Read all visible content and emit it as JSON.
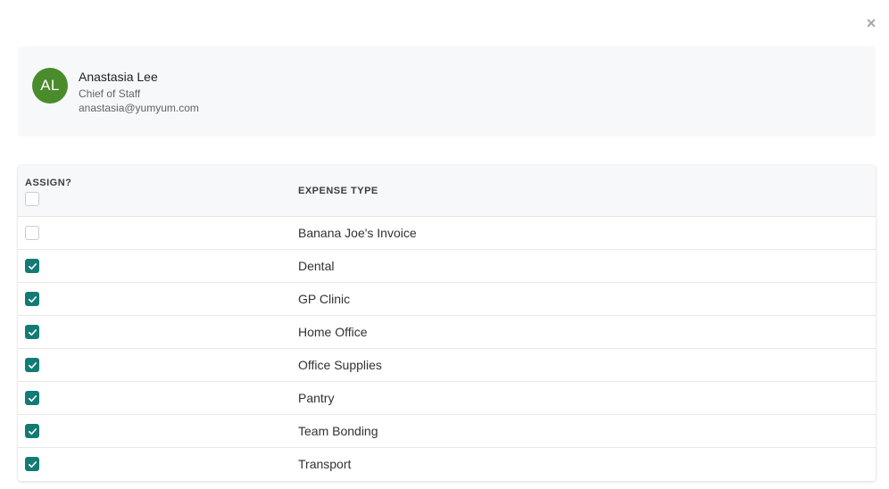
{
  "close_label": "×",
  "profile": {
    "initials": "AL",
    "name": "Anastasia Lee",
    "role": "Chief of Staff",
    "email": "anastasia@yumyum.com"
  },
  "table": {
    "header_assign": "ASSIGN?",
    "header_type": "EXPENSE TYPE",
    "header_checked": false,
    "rows": [
      {
        "label": "Banana Joe's Invoice",
        "checked": false
      },
      {
        "label": "Dental",
        "checked": true
      },
      {
        "label": "GP Clinic",
        "checked": true
      },
      {
        "label": "Home Office",
        "checked": true
      },
      {
        "label": "Office Supplies",
        "checked": true
      },
      {
        "label": "Pantry",
        "checked": true
      },
      {
        "label": "Team Bonding",
        "checked": true
      },
      {
        "label": "Transport",
        "checked": true
      }
    ]
  },
  "colors": {
    "avatar_bg": "#4a8b2c",
    "check_accent": "#137a74"
  }
}
